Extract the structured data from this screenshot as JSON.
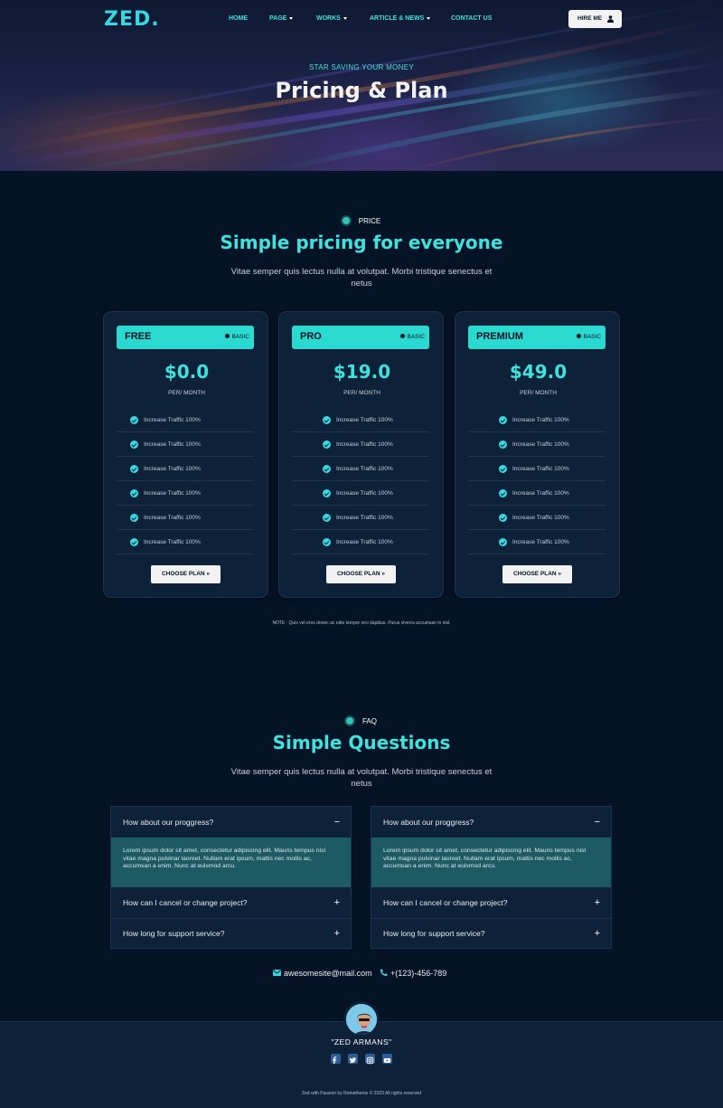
{
  "header": {
    "logo_text": "ZED",
    "logo_dot": ".",
    "nav": [
      "HOME",
      "PAGE",
      "WORKS",
      "ARTICLE & NEWS",
      "CONTACT US"
    ],
    "hire_label": "HIRE ME"
  },
  "hero": {
    "subtitle": "STAR SAVING YOUR MONEY",
    "title": "Pricing & Plan"
  },
  "pricing": {
    "tag": "PRICE",
    "title": "Simple pricing for everyone",
    "description": "Vitae semper quis lectus nulla at volutpat. Morbi tristique senectus et netus",
    "plans": [
      {
        "name": "FREE",
        "badge": "BASIC",
        "price": "$0.0",
        "period": "PER/ MONTH",
        "features": [
          "Increase Traffic 100%",
          "Increase Traffic 100%",
          "Increase Traffic 100%",
          "Increase Traffic 100%",
          "Increase Traffic 100%",
          "Increase Traffic 100%"
        ],
        "button": "CHOOSE PLAN »"
      },
      {
        "name": "PRO",
        "badge": "BASIC",
        "price": "$19.0",
        "period": "PER/ MONTH",
        "features": [
          "Increase Traffic 100%",
          "Increase Traffic 100%",
          "Increase Traffic 100%",
          "Increase Traffic 100%",
          "Increase Traffic 100%",
          "Increase Traffic 100%"
        ],
        "button": "CHOOSE PLAN »"
      },
      {
        "name": "PREMIUM",
        "badge": "BASIC",
        "price": "$49.0",
        "period": "PER/ MONTH",
        "features": [
          "Increase Traffic 100%",
          "Increase Traffic 100%",
          "Increase Traffic 100%",
          "Increase Traffic 100%",
          "Increase Traffic 100%",
          "Increase Traffic 100%"
        ],
        "button": "CHOOSE PLAN »"
      }
    ],
    "note": "NOTE : Quis vel eros donec ac odio tempor orci dapibus. Purus viverra accumsan in nisl."
  },
  "faq": {
    "tag": "FAQ",
    "title": "Simple Questions",
    "description": "Vitae semper quis lectus nulla at volutpat. Morbi tristique senectus et netus",
    "columns": [
      {
        "open_question": "How about our proggress?",
        "answer": "Lorem ipsum dolor sit amet, consectetur adipiscing elit. Mauris tempus nisl vitae magna pulvinar laoreet. Nullam erat ipsum, mattis nec mollis ac, accumsan a enim. Nunc at euismod arcu.",
        "questions": [
          "How can I cancel or change project?",
          "How long for support service?"
        ]
      },
      {
        "open_question": "How about our proggress?",
        "answer": "Lorem ipsum dolor sit amet, consectetur adipiscing elit. Mauris tempus nisl vitae magna pulvinar laoreet. Nullam erat ipsum, mattis nec mollis ac, accumsan a enim. Nunc at euismod arcu.",
        "questions": [
          "How can I cancel or change project?",
          "How long for support service?"
        ]
      }
    ],
    "minus": "−",
    "plus": "+"
  },
  "contact": {
    "email": "awesomesite@mail.com",
    "phone": "+(123)-456-789"
  },
  "footer": {
    "name": "\"ZED ARMANS\"",
    "social_icons": [
      "facebook-icon",
      "twitter-icon",
      "instagram-icon",
      "youtube-icon"
    ],
    "copyright": "Zed with Passion by Rometheme © 2023 All rights reserved"
  },
  "colors": {
    "accent": "#3fe3dd",
    "background": "#051326",
    "card": "#0d2139",
    "faq_answer": "#1e5a63"
  }
}
